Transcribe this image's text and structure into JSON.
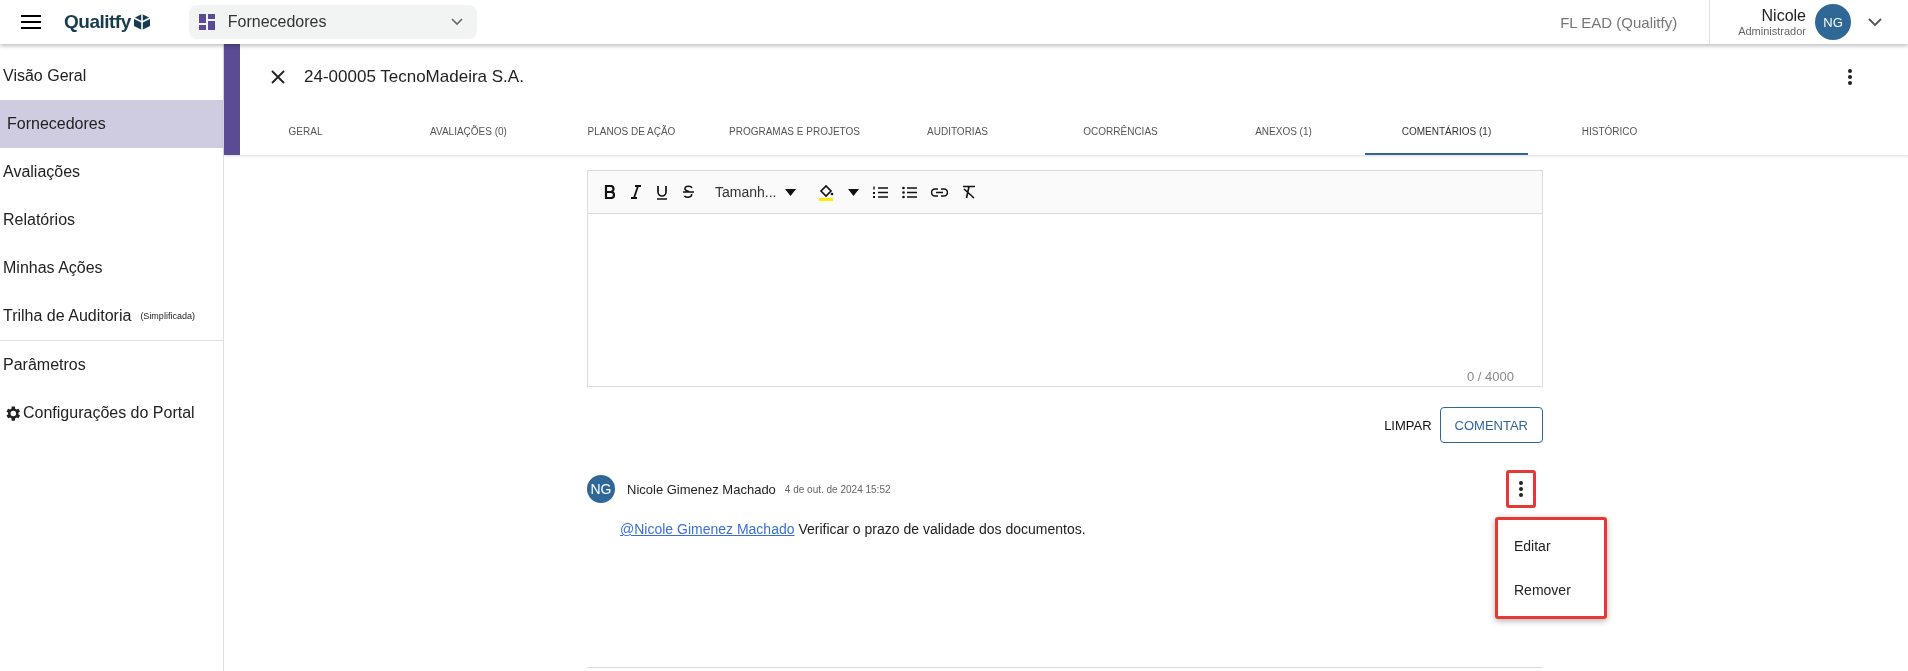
{
  "topbar": {
    "logo": "Qualitfy",
    "module": "Fornecedores",
    "tenant": "FL EAD (Qualitfy)",
    "user": {
      "name": "Nicole",
      "role": "Administrador",
      "initials": "NG"
    }
  },
  "sidebar": {
    "groups": [
      {
        "items": [
          {
            "kind": "text",
            "label": "Visão Geral",
            "selected": false
          },
          {
            "kind": "text",
            "label": "Fornecedores",
            "selected": true
          },
          {
            "kind": "text",
            "label": "Avaliações",
            "selected": false
          },
          {
            "kind": "text",
            "label": "Relatórios",
            "selected": false
          },
          {
            "kind": "text",
            "label": "Minhas Ações",
            "selected": false
          },
          {
            "kind": "text",
            "label": "Trilha de Auditoria",
            "note": "(Simplificada)",
            "selected": false
          }
        ]
      },
      {
        "items": [
          {
            "kind": "text",
            "label": "Parâmetros",
            "selected": false
          },
          {
            "kind": "settings",
            "label": "Configurações do Portal",
            "selected": false
          }
        ]
      }
    ]
  },
  "record": {
    "title": "24-00005 TecnoMadeira S.A."
  },
  "tabs": [
    {
      "label": "GERAL",
      "selected": false
    },
    {
      "label": "AVALIAÇÕES (0)",
      "selected": false
    },
    {
      "label": "PLANOS DE AÇÃO",
      "selected": false
    },
    {
      "label": "PROGRAMAS E PROJETOS",
      "selected": false
    },
    {
      "label": "AUDITORIAS",
      "selected": false
    },
    {
      "label": "OCORRÊNCIAS",
      "selected": false
    },
    {
      "label": "ANEXOS (1)",
      "selected": false
    },
    {
      "label": "COMENTÁRIOS (1)",
      "selected": true
    },
    {
      "label": "HISTÓRICO",
      "selected": false
    }
  ],
  "editor": {
    "size_dropdown": "Tamanh...",
    "counter": "0 / 4000",
    "buttons": [
      "LIMPAR",
      "COMENTAR"
    ]
  },
  "comments": [
    {
      "initials": "NG",
      "author": "Nicole Gimenez Machado",
      "date": "4 de out. de 2024 15:52",
      "mention": "@Nicole Gimenez Machado",
      "text": "Verificar o prazo de validade dos documentos.",
      "menu": {
        "open": true,
        "items": [
          "Editar",
          "Remover"
        ]
      }
    }
  ]
}
